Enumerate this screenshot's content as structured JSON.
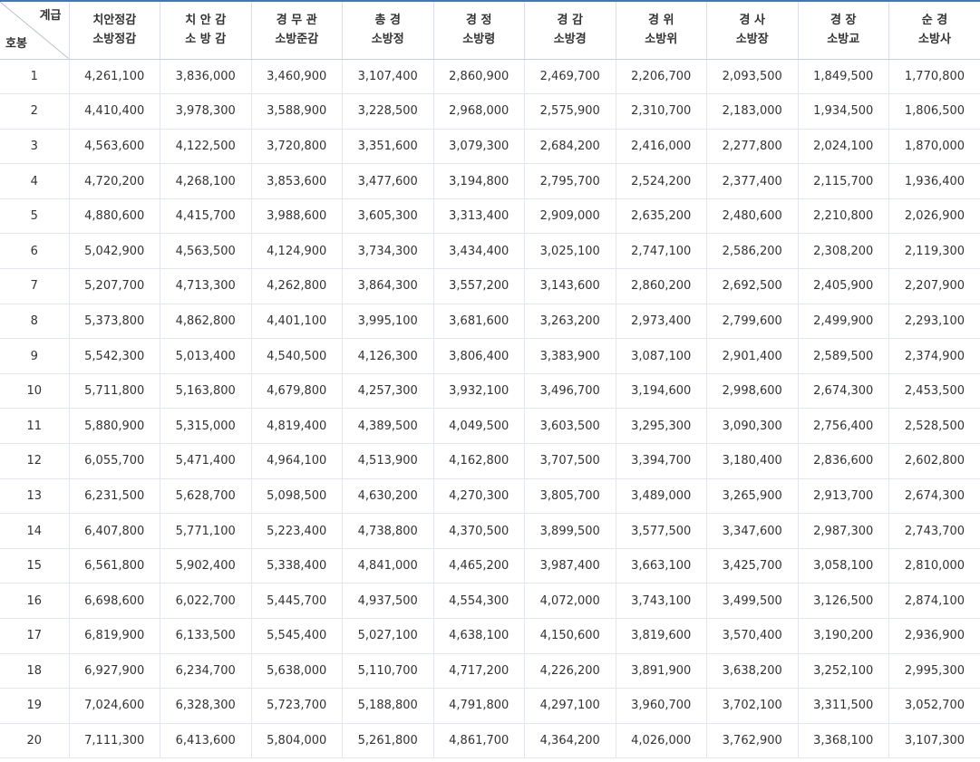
{
  "corner": {
    "top": "계급",
    "bottom": "호봉"
  },
  "columns": [
    {
      "line1": "치안정감",
      "line2": "소방정감"
    },
    {
      "line1": "치 안 감",
      "line2": "소 방 감"
    },
    {
      "line1": "경 무 관",
      "line2": "소방준감"
    },
    {
      "line1": "총 경",
      "line2": "소방정"
    },
    {
      "line1": "경 정",
      "line2": "소방령"
    },
    {
      "line1": "경 감",
      "line2": "소방경"
    },
    {
      "line1": "경 위",
      "line2": "소방위"
    },
    {
      "line1": "경 사",
      "line2": "소방장"
    },
    {
      "line1": "경 장",
      "line2": "소방교"
    },
    {
      "line1": "순 경",
      "line2": "소방사"
    }
  ],
  "rows": [
    [
      "1",
      "4,261,100",
      "3,836,000",
      "3,460,900",
      "3,107,400",
      "2,860,900",
      "2,469,700",
      "2,206,700",
      "2,093,500",
      "1,849,500",
      "1,770,800"
    ],
    [
      "2",
      "4,410,400",
      "3,978,300",
      "3,588,900",
      "3,228,500",
      "2,968,000",
      "2,575,900",
      "2,310,700",
      "2,183,000",
      "1,934,500",
      "1,806,500"
    ],
    [
      "3",
      "4,563,600",
      "4,122,500",
      "3,720,800",
      "3,351,600",
      "3,079,300",
      "2,684,200",
      "2,416,000",
      "2,277,800",
      "2,024,100",
      "1,870,000"
    ],
    [
      "4",
      "4,720,200",
      "4,268,100",
      "3,853,600",
      "3,477,600",
      "3,194,800",
      "2,795,700",
      "2,524,200",
      "2,377,400",
      "2,115,700",
      "1,936,400"
    ],
    [
      "5",
      "4,880,600",
      "4,415,700",
      "3,988,600",
      "3,605,300",
      "3,313,400",
      "2,909,000",
      "2,635,200",
      "2,480,600",
      "2,210,800",
      "2,026,900"
    ],
    [
      "6",
      "5,042,900",
      "4,563,500",
      "4,124,900",
      "3,734,300",
      "3,434,400",
      "3,025,100",
      "2,747,100",
      "2,586,200",
      "2,308,200",
      "2,119,300"
    ],
    [
      "7",
      "5,207,700",
      "4,713,300",
      "4,262,800",
      "3,864,300",
      "3,557,200",
      "3,143,600",
      "2,860,200",
      "2,692,500",
      "2,405,900",
      "2,207,900"
    ],
    [
      "8",
      "5,373,800",
      "4,862,800",
      "4,401,100",
      "3,995,100",
      "3,681,600",
      "3,263,200",
      "2,973,400",
      "2,799,600",
      "2,499,900",
      "2,293,100"
    ],
    [
      "9",
      "5,542,300",
      "5,013,400",
      "4,540,500",
      "4,126,300",
      "3,806,400",
      "3,383,900",
      "3,087,100",
      "2,901,400",
      "2,589,500",
      "2,374,900"
    ],
    [
      "10",
      "5,711,800",
      "5,163,800",
      "4,679,800",
      "4,257,300",
      "3,932,100",
      "3,496,700",
      "3,194,600",
      "2,998,600",
      "2,674,300",
      "2,453,500"
    ],
    [
      "11",
      "5,880,900",
      "5,315,000",
      "4,819,400",
      "4,389,500",
      "4,049,500",
      "3,603,500",
      "3,295,300",
      "3,090,300",
      "2,756,400",
      "2,528,500"
    ],
    [
      "12",
      "6,055,700",
      "5,471,400",
      "4,964,100",
      "4,513,900",
      "4,162,800",
      "3,707,500",
      "3,394,700",
      "3,180,400",
      "2,836,600",
      "2,602,800"
    ],
    [
      "13",
      "6,231,500",
      "5,628,700",
      "5,098,500",
      "4,630,200",
      "4,270,300",
      "3,805,700",
      "3,489,000",
      "3,265,900",
      "2,913,700",
      "2,674,300"
    ],
    [
      "14",
      "6,407,800",
      "5,771,100",
      "5,223,400",
      "4,738,800",
      "4,370,500",
      "3,899,500",
      "3,577,500",
      "3,347,600",
      "2,987,300",
      "2,743,700"
    ],
    [
      "15",
      "6,561,800",
      "5,902,400",
      "5,338,400",
      "4,841,000",
      "4,465,200",
      "3,987,400",
      "3,663,100",
      "3,425,700",
      "3,058,100",
      "2,810,000"
    ],
    [
      "16",
      "6,698,600",
      "6,022,700",
      "5,445,700",
      "4,937,500",
      "4,554,300",
      "4,072,000",
      "3,743,100",
      "3,499,500",
      "3,126,500",
      "2,874,100"
    ],
    [
      "17",
      "6,819,900",
      "6,133,500",
      "5,545,400",
      "5,027,100",
      "4,638,100",
      "4,150,600",
      "3,819,600",
      "3,570,400",
      "3,190,200",
      "2,936,900"
    ],
    [
      "18",
      "6,927,900",
      "6,234,700",
      "5,638,000",
      "5,110,700",
      "4,717,200",
      "4,226,200",
      "3,891,900",
      "3,638,200",
      "3,252,100",
      "2,995,300"
    ],
    [
      "19",
      "7,024,600",
      "6,328,300",
      "5,723,700",
      "5,188,800",
      "4,791,800",
      "4,297,100",
      "3,960,700",
      "3,702,100",
      "3,311,500",
      "3,052,700"
    ],
    [
      "20",
      "7,111,300",
      "6,413,600",
      "5,804,000",
      "5,261,800",
      "4,861,700",
      "4,364,200",
      "4,026,000",
      "3,762,900",
      "3,368,100",
      "3,107,300"
    ]
  ]
}
